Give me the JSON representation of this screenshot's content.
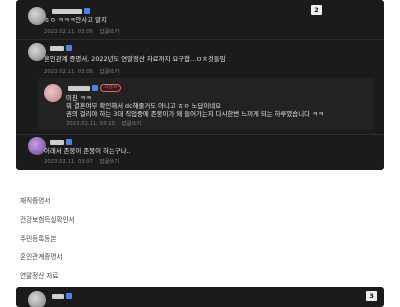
{
  "comments": {
    "c1": {
      "text": "ㅎㅇ ㅋㅋㅋ안사고 말지",
      "date": "2023.02.11. 03:06",
      "reply": "답글쓰기",
      "badge": "2"
    },
    "c2": {
      "text": "혼인관계 증명서, 2022년도 연말정산 자료까지 요구함...ㅁㅊ것들임",
      "date": "2023.02.11. 03:06",
      "reply": "답글쓰기"
    },
    "c3": {
      "author_tag": "작성자",
      "line1": "미친 ㅋㅋ",
      "line2": "뭐 결혼여부 확인해서 dc해줄거도 아니고 ㅎㅇ 노답이네요",
      "line3": "권의 걸리야 하는 3대 직업중에 존붕이가 왜 들어가는지 다시한번 느끼게 되는 하루였습니다 ㅋㅋ",
      "date": "2023.02.11. 03:10",
      "reply": "답글쓰기"
    },
    "c4": {
      "text": "이래서 존붕이 존붕이 하는구나..",
      "date": "2023.02.11. 03:07",
      "reply": "답글쓰기"
    }
  },
  "documents": [
    "재직증명서",
    "건강보험득실확인서",
    "주민등록등본",
    "혼인관계증명서",
    "연말정산 자료"
  ],
  "comment_bottom": {
    "badge": "3"
  },
  "colors": {
    "panel_bg": "#1b1b1b",
    "accent_blue": "#4b84e7",
    "author_red": "#ff5a5a"
  }
}
